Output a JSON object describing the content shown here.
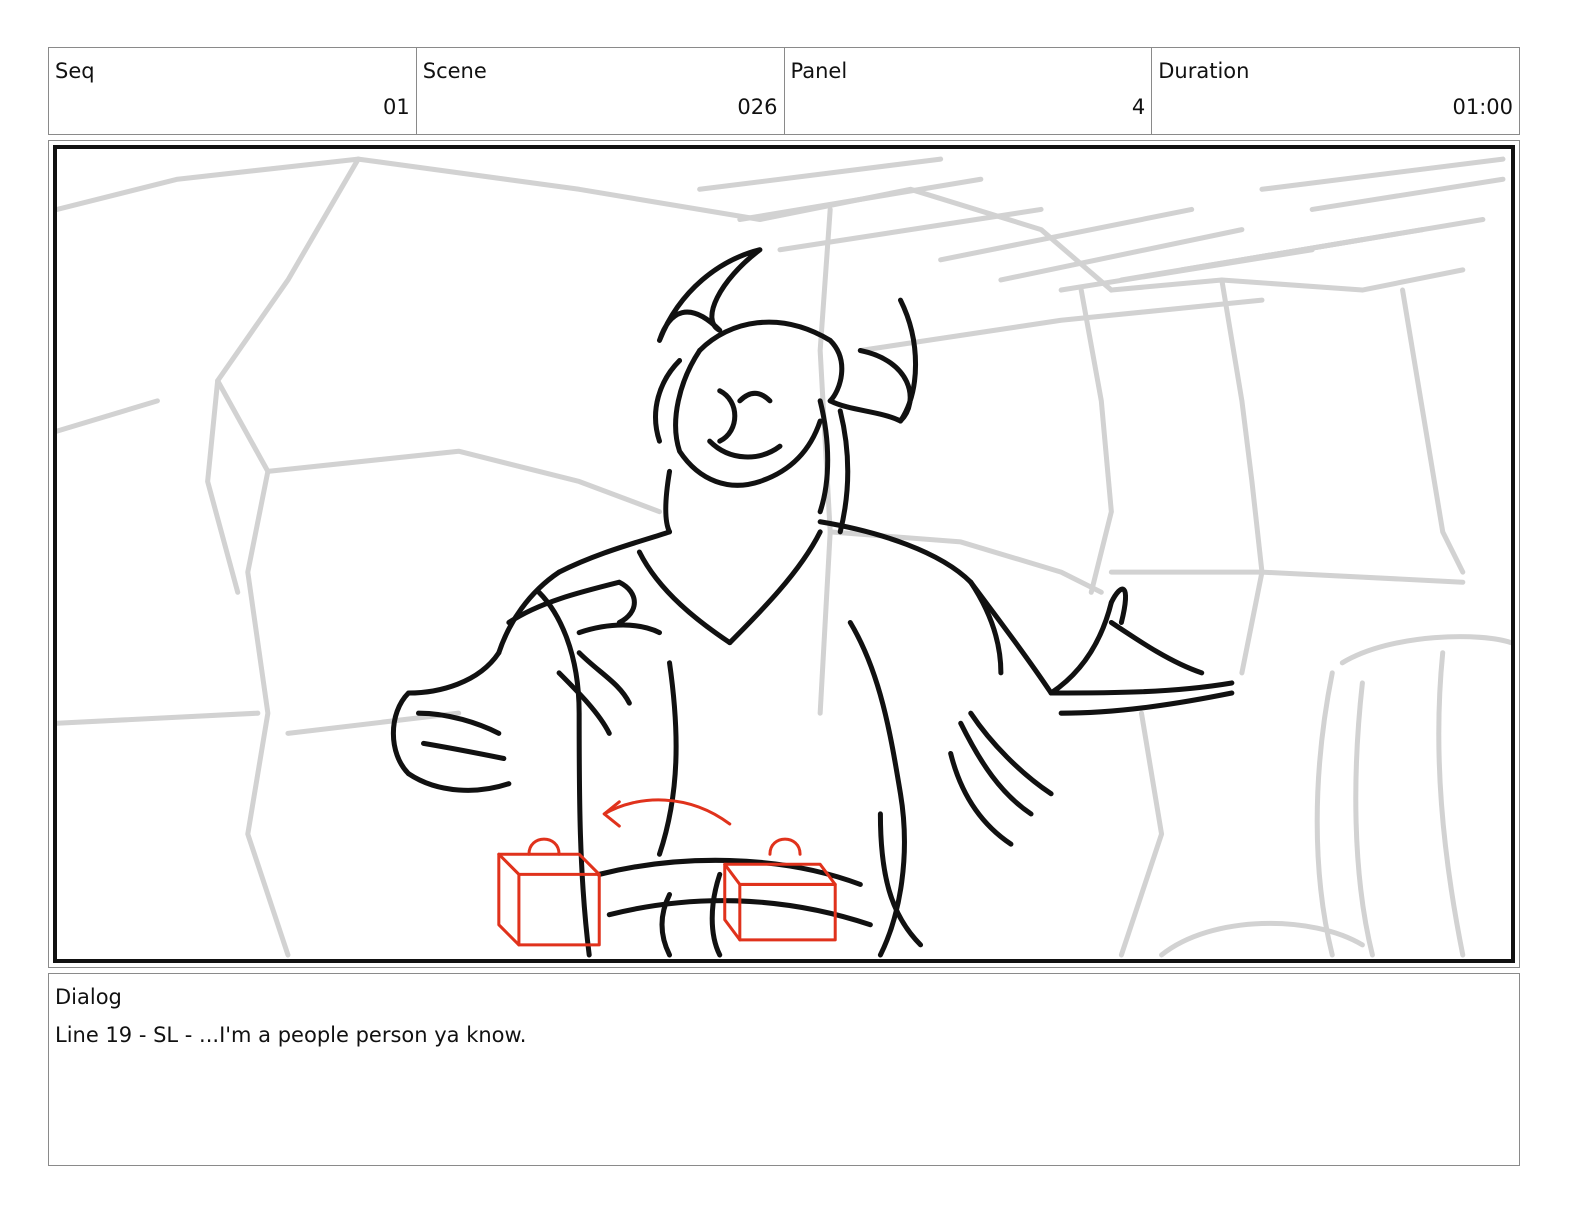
{
  "header": {
    "seq_label": "Seq",
    "seq_value": "01",
    "scene_label": "Scene",
    "scene_value": "026",
    "panel_label": "Panel",
    "panel_value": "4",
    "duration_label": "Duration",
    "duration_value": "01:00"
  },
  "dialog": {
    "label": "Dialog",
    "text": "Line 19 - SL - ...I'm a people person ya know."
  },
  "colors": {
    "sketch_line": "#111111",
    "background_sketch": "#d2d2d2",
    "annotation_red": "#e0321c",
    "border": "#8a8a8a"
  }
}
